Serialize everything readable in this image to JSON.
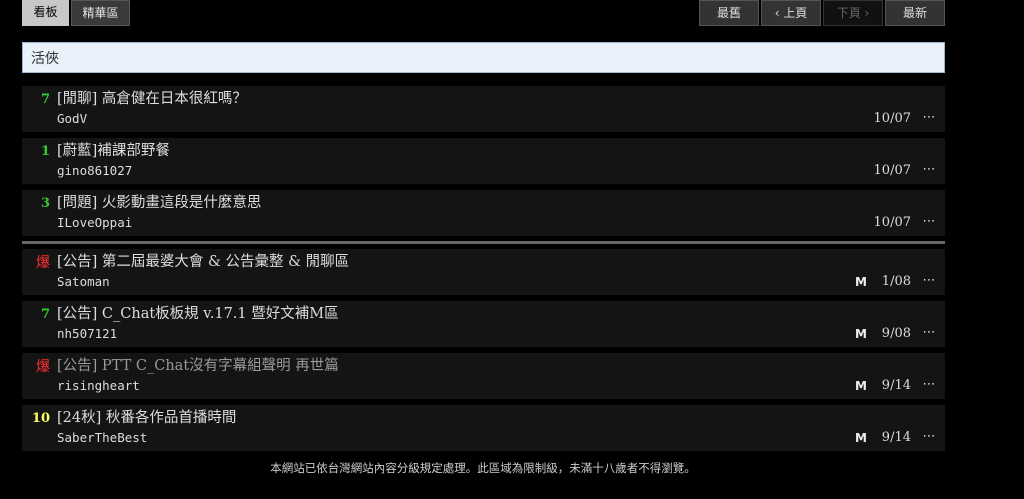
{
  "tabs": {
    "board": "看板",
    "digest": "精華區"
  },
  "pager": {
    "oldest": "最舊",
    "prev": "‹ 上頁",
    "next": "下頁 ›",
    "latest": "最新"
  },
  "search": {
    "value": "活俠"
  },
  "posts": [
    {
      "nrec": "7",
      "title": "[閒聊] 高倉健在日本很紅嗎？",
      "author": "GodV",
      "mark": "",
      "date": "10/07",
      "more": "⋯"
    },
    {
      "nrec": "1",
      "title": "[蔚藍]補課部野餐",
      "author": "gino861027",
      "mark": "",
      "date": "10/07",
      "more": "⋯"
    },
    {
      "nrec": "3",
      "title": "[問題] 火影動畫這段是什麼意思",
      "author": "ILoveOppai",
      "mark": "",
      "date": "10/07",
      "more": "⋯"
    }
  ],
  "pinned": [
    {
      "nrec": "爆",
      "title": "[公告] 第二屆最婆大會 & 公告彙整 & 閒聊區",
      "author": "Satoman",
      "mark": "M",
      "date": "1/08",
      "more": "⋯"
    },
    {
      "nrec": "7",
      "title": "[公告] C_Chat板板規 v.17.1 暨好文補M區",
      "author": "nh507121",
      "mark": "M",
      "date": "9/08",
      "more": "⋯"
    },
    {
      "nrec": "爆",
      "title": "[公告] PTT C_Chat沒有字幕組聲明 再世篇",
      "author": "risingheart",
      "mark": "M",
      "date": "9/14",
      "more": "⋯"
    },
    {
      "nrec": "10",
      "title": "[24秋] 秋番各作品首播時間",
      "author": "SaberTheBest",
      "mark": "M",
      "date": "9/14",
      "more": "⋯"
    }
  ],
  "footer": "本網站已依台灣網站內容分級規定處理。此區域為限制級，未滿十八歲者不得瀏覽。",
  "colors": {
    "nrec_green": "#33cc33",
    "nrec_yellow": "#ffff66",
    "nrec_hot": "#ff3333",
    "search_bg": "#e9f1fb"
  }
}
